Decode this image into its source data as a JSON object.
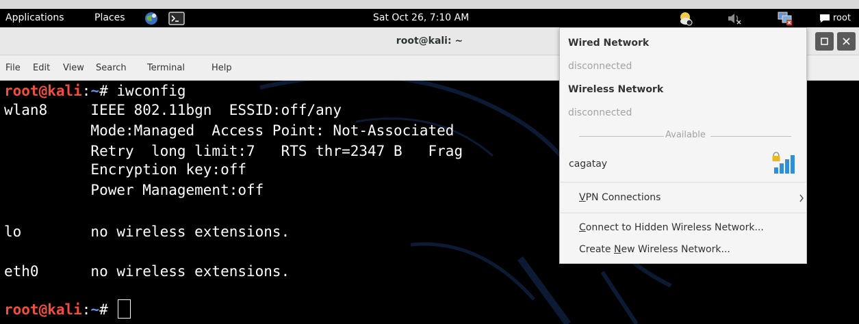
{
  "panel": {
    "applications": "Applications",
    "places": "Places",
    "clock": "Sat Oct 26,  7:10 AM",
    "user": "root",
    "icons": [
      "browser-icon",
      "terminal-launcher-icon",
      "weather-icon",
      "volume-muted-icon",
      "network-disconnected-icon",
      "chat-icon"
    ]
  },
  "window": {
    "title": "root@kali: ~",
    "controls": [
      "maximize",
      "close"
    ]
  },
  "menu": {
    "file": "File",
    "edit": "Edit",
    "view": "View",
    "search": "Search",
    "terminal": "Terminal",
    "help": "Help"
  },
  "terminal": {
    "prompt_user": "root@kali",
    "prompt_sep": ":",
    "prompt_path": "~",
    "prompt_hash": "# ",
    "command": "iwconfig",
    "lines": [
      "wlan8     IEEE 802.11bgn  ESSID:off/any",
      "          Mode:Managed  Access Point: Not-Associated",
      "          Retry  long limit:7   RTS thr=2347 B   Frag",
      "          Encryption key:off",
      "          Power Management:off",
      "lo        no wireless extensions.",
      "eth0      no wireless extensions."
    ]
  },
  "network_menu": {
    "wired_header": "Wired Network",
    "wired_status": "disconnected",
    "wireless_header": "Wireless Network",
    "wireless_status": "disconnected",
    "available_label": "Available",
    "networks": [
      {
        "ssid": "cagatay",
        "secured": true,
        "signal": 1.0
      }
    ],
    "vpn_pre": "",
    "vpn_u": "V",
    "vpn_post": "PN Connections",
    "hidden_pre": "",
    "hidden_u": "C",
    "hidden_post": "onnect to Hidden Wireless Network...",
    "create_pre": "Create ",
    "create_u": "N",
    "create_post": "ew Wireless Network..."
  }
}
